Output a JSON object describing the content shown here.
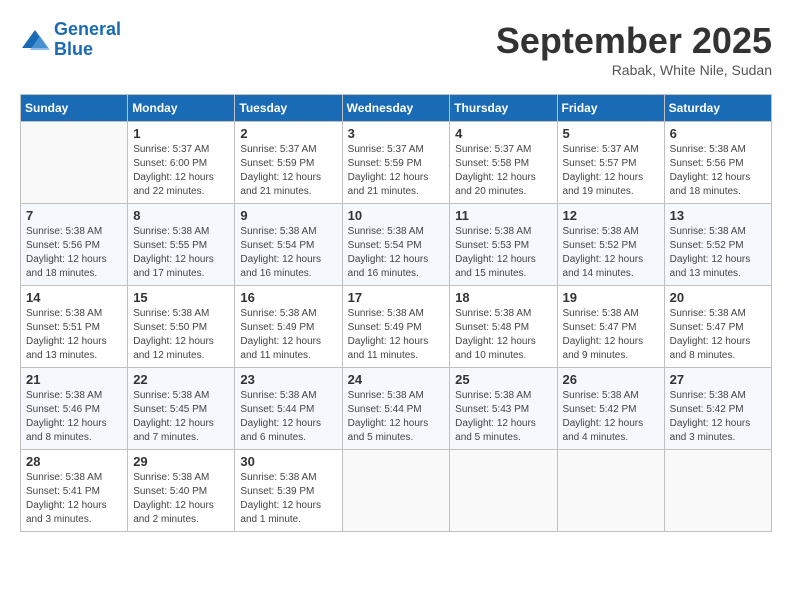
{
  "logo": {
    "line1": "General",
    "line2": "Blue"
  },
  "header": {
    "month_year": "September 2025",
    "location": "Rabak, White Nile, Sudan"
  },
  "days_of_week": [
    "Sunday",
    "Monday",
    "Tuesday",
    "Wednesday",
    "Thursday",
    "Friday",
    "Saturday"
  ],
  "weeks": [
    [
      {
        "day": "",
        "info": ""
      },
      {
        "day": "1",
        "info": "Sunrise: 5:37 AM\nSunset: 6:00 PM\nDaylight: 12 hours\nand 22 minutes."
      },
      {
        "day": "2",
        "info": "Sunrise: 5:37 AM\nSunset: 5:59 PM\nDaylight: 12 hours\nand 21 minutes."
      },
      {
        "day": "3",
        "info": "Sunrise: 5:37 AM\nSunset: 5:59 PM\nDaylight: 12 hours\nand 21 minutes."
      },
      {
        "day": "4",
        "info": "Sunrise: 5:37 AM\nSunset: 5:58 PM\nDaylight: 12 hours\nand 20 minutes."
      },
      {
        "day": "5",
        "info": "Sunrise: 5:37 AM\nSunset: 5:57 PM\nDaylight: 12 hours\nand 19 minutes."
      },
      {
        "day": "6",
        "info": "Sunrise: 5:38 AM\nSunset: 5:56 PM\nDaylight: 12 hours\nand 18 minutes."
      }
    ],
    [
      {
        "day": "7",
        "info": "Sunrise: 5:38 AM\nSunset: 5:56 PM\nDaylight: 12 hours\nand 18 minutes."
      },
      {
        "day": "8",
        "info": "Sunrise: 5:38 AM\nSunset: 5:55 PM\nDaylight: 12 hours\nand 17 minutes."
      },
      {
        "day": "9",
        "info": "Sunrise: 5:38 AM\nSunset: 5:54 PM\nDaylight: 12 hours\nand 16 minutes."
      },
      {
        "day": "10",
        "info": "Sunrise: 5:38 AM\nSunset: 5:54 PM\nDaylight: 12 hours\nand 16 minutes."
      },
      {
        "day": "11",
        "info": "Sunrise: 5:38 AM\nSunset: 5:53 PM\nDaylight: 12 hours\nand 15 minutes."
      },
      {
        "day": "12",
        "info": "Sunrise: 5:38 AM\nSunset: 5:52 PM\nDaylight: 12 hours\nand 14 minutes."
      },
      {
        "day": "13",
        "info": "Sunrise: 5:38 AM\nSunset: 5:52 PM\nDaylight: 12 hours\nand 13 minutes."
      }
    ],
    [
      {
        "day": "14",
        "info": "Sunrise: 5:38 AM\nSunset: 5:51 PM\nDaylight: 12 hours\nand 13 minutes."
      },
      {
        "day": "15",
        "info": "Sunrise: 5:38 AM\nSunset: 5:50 PM\nDaylight: 12 hours\nand 12 minutes."
      },
      {
        "day": "16",
        "info": "Sunrise: 5:38 AM\nSunset: 5:49 PM\nDaylight: 12 hours\nand 11 minutes."
      },
      {
        "day": "17",
        "info": "Sunrise: 5:38 AM\nSunset: 5:49 PM\nDaylight: 12 hours\nand 11 minutes."
      },
      {
        "day": "18",
        "info": "Sunrise: 5:38 AM\nSunset: 5:48 PM\nDaylight: 12 hours\nand 10 minutes."
      },
      {
        "day": "19",
        "info": "Sunrise: 5:38 AM\nSunset: 5:47 PM\nDaylight: 12 hours\nand 9 minutes."
      },
      {
        "day": "20",
        "info": "Sunrise: 5:38 AM\nSunset: 5:47 PM\nDaylight: 12 hours\nand 8 minutes."
      }
    ],
    [
      {
        "day": "21",
        "info": "Sunrise: 5:38 AM\nSunset: 5:46 PM\nDaylight: 12 hours\nand 8 minutes."
      },
      {
        "day": "22",
        "info": "Sunrise: 5:38 AM\nSunset: 5:45 PM\nDaylight: 12 hours\nand 7 minutes."
      },
      {
        "day": "23",
        "info": "Sunrise: 5:38 AM\nSunset: 5:44 PM\nDaylight: 12 hours\nand 6 minutes."
      },
      {
        "day": "24",
        "info": "Sunrise: 5:38 AM\nSunset: 5:44 PM\nDaylight: 12 hours\nand 5 minutes."
      },
      {
        "day": "25",
        "info": "Sunrise: 5:38 AM\nSunset: 5:43 PM\nDaylight: 12 hours\nand 5 minutes."
      },
      {
        "day": "26",
        "info": "Sunrise: 5:38 AM\nSunset: 5:42 PM\nDaylight: 12 hours\nand 4 minutes."
      },
      {
        "day": "27",
        "info": "Sunrise: 5:38 AM\nSunset: 5:42 PM\nDaylight: 12 hours\nand 3 minutes."
      }
    ],
    [
      {
        "day": "28",
        "info": "Sunrise: 5:38 AM\nSunset: 5:41 PM\nDaylight: 12 hours\nand 3 minutes."
      },
      {
        "day": "29",
        "info": "Sunrise: 5:38 AM\nSunset: 5:40 PM\nDaylight: 12 hours\nand 2 minutes."
      },
      {
        "day": "30",
        "info": "Sunrise: 5:38 AM\nSunset: 5:39 PM\nDaylight: 12 hours\nand 1 minute."
      },
      {
        "day": "",
        "info": ""
      },
      {
        "day": "",
        "info": ""
      },
      {
        "day": "",
        "info": ""
      },
      {
        "day": "",
        "info": ""
      }
    ]
  ]
}
